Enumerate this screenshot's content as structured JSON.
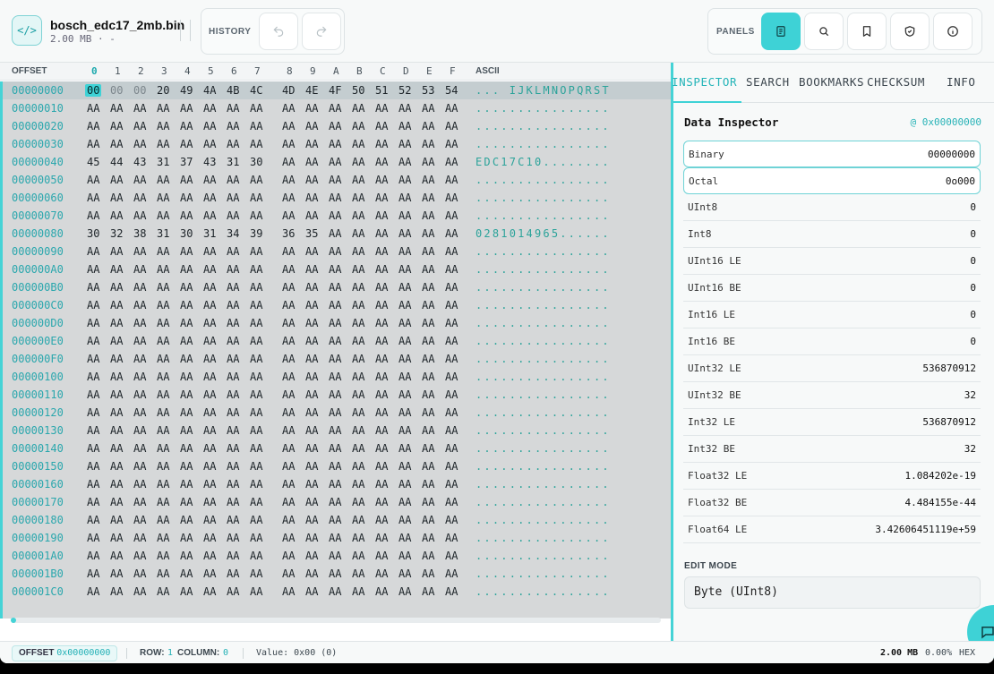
{
  "file": {
    "icon": "code-icon",
    "name": "bosch_edc17_2mb.bin",
    "meta": "2.00 MB · -"
  },
  "history": {
    "label": "HISTORY",
    "undo_icon": "undo-icon",
    "redo_icon": "redo-icon"
  },
  "panels": {
    "label": "PANELS",
    "buttons": [
      "document-icon",
      "search-icon",
      "bookmark-icon",
      "shield-check-icon",
      "info-icon"
    ]
  },
  "hex": {
    "offset_label": "OFFSET",
    "ascii_label": "ASCII",
    "columns": [
      "0",
      "1",
      "2",
      "3",
      "4",
      "5",
      "6",
      "7",
      "8",
      "9",
      "A",
      "B",
      "C",
      "D",
      "E",
      "F"
    ],
    "rows": [
      {
        "offset": "00000000",
        "bytes": [
          "00",
          "00",
          "00",
          "20",
          "49",
          "4A",
          "4B",
          "4C",
          "4D",
          "4E",
          "4F",
          "50",
          "51",
          "52",
          "53",
          "54"
        ],
        "ascii": "... IJKLMNOPQRST"
      },
      {
        "offset": "00000010",
        "bytes": [
          "AA",
          "AA",
          "AA",
          "AA",
          "AA",
          "AA",
          "AA",
          "AA",
          "AA",
          "AA",
          "AA",
          "AA",
          "AA",
          "AA",
          "AA",
          "AA"
        ],
        "ascii": "................"
      },
      {
        "offset": "00000020",
        "bytes": [
          "AA",
          "AA",
          "AA",
          "AA",
          "AA",
          "AA",
          "AA",
          "AA",
          "AA",
          "AA",
          "AA",
          "AA",
          "AA",
          "AA",
          "AA",
          "AA"
        ],
        "ascii": "................"
      },
      {
        "offset": "00000030",
        "bytes": [
          "AA",
          "AA",
          "AA",
          "AA",
          "AA",
          "AA",
          "AA",
          "AA",
          "AA",
          "AA",
          "AA",
          "AA",
          "AA",
          "AA",
          "AA",
          "AA"
        ],
        "ascii": "................"
      },
      {
        "offset": "00000040",
        "bytes": [
          "45",
          "44",
          "43",
          "31",
          "37",
          "43",
          "31",
          "30",
          "AA",
          "AA",
          "AA",
          "AA",
          "AA",
          "AA",
          "AA",
          "AA"
        ],
        "ascii": "EDC17C10........"
      },
      {
        "offset": "00000050",
        "bytes": [
          "AA",
          "AA",
          "AA",
          "AA",
          "AA",
          "AA",
          "AA",
          "AA",
          "AA",
          "AA",
          "AA",
          "AA",
          "AA",
          "AA",
          "AA",
          "AA"
        ],
        "ascii": "................"
      },
      {
        "offset": "00000060",
        "bytes": [
          "AA",
          "AA",
          "AA",
          "AA",
          "AA",
          "AA",
          "AA",
          "AA",
          "AA",
          "AA",
          "AA",
          "AA",
          "AA",
          "AA",
          "AA",
          "AA"
        ],
        "ascii": "................"
      },
      {
        "offset": "00000070",
        "bytes": [
          "AA",
          "AA",
          "AA",
          "AA",
          "AA",
          "AA",
          "AA",
          "AA",
          "AA",
          "AA",
          "AA",
          "AA",
          "AA",
          "AA",
          "AA",
          "AA"
        ],
        "ascii": "................"
      },
      {
        "offset": "00000080",
        "bytes": [
          "30",
          "32",
          "38",
          "31",
          "30",
          "31",
          "34",
          "39",
          "36",
          "35",
          "AA",
          "AA",
          "AA",
          "AA",
          "AA",
          "AA"
        ],
        "ascii": "0281014965......"
      },
      {
        "offset": "00000090",
        "bytes": [
          "AA",
          "AA",
          "AA",
          "AA",
          "AA",
          "AA",
          "AA",
          "AA",
          "AA",
          "AA",
          "AA",
          "AA",
          "AA",
          "AA",
          "AA",
          "AA"
        ],
        "ascii": "................"
      },
      {
        "offset": "000000A0",
        "bytes": [
          "AA",
          "AA",
          "AA",
          "AA",
          "AA",
          "AA",
          "AA",
          "AA",
          "AA",
          "AA",
          "AA",
          "AA",
          "AA",
          "AA",
          "AA",
          "AA"
        ],
        "ascii": "................"
      },
      {
        "offset": "000000B0",
        "bytes": [
          "AA",
          "AA",
          "AA",
          "AA",
          "AA",
          "AA",
          "AA",
          "AA",
          "AA",
          "AA",
          "AA",
          "AA",
          "AA",
          "AA",
          "AA",
          "AA"
        ],
        "ascii": "................"
      },
      {
        "offset": "000000C0",
        "bytes": [
          "AA",
          "AA",
          "AA",
          "AA",
          "AA",
          "AA",
          "AA",
          "AA",
          "AA",
          "AA",
          "AA",
          "AA",
          "AA",
          "AA",
          "AA",
          "AA"
        ],
        "ascii": "................"
      },
      {
        "offset": "000000D0",
        "bytes": [
          "AA",
          "AA",
          "AA",
          "AA",
          "AA",
          "AA",
          "AA",
          "AA",
          "AA",
          "AA",
          "AA",
          "AA",
          "AA",
          "AA",
          "AA",
          "AA"
        ],
        "ascii": "................"
      },
      {
        "offset": "000000E0",
        "bytes": [
          "AA",
          "AA",
          "AA",
          "AA",
          "AA",
          "AA",
          "AA",
          "AA",
          "AA",
          "AA",
          "AA",
          "AA",
          "AA",
          "AA",
          "AA",
          "AA"
        ],
        "ascii": "................"
      },
      {
        "offset": "000000F0",
        "bytes": [
          "AA",
          "AA",
          "AA",
          "AA",
          "AA",
          "AA",
          "AA",
          "AA",
          "AA",
          "AA",
          "AA",
          "AA",
          "AA",
          "AA",
          "AA",
          "AA"
        ],
        "ascii": "................"
      },
      {
        "offset": "00000100",
        "bytes": [
          "AA",
          "AA",
          "AA",
          "AA",
          "AA",
          "AA",
          "AA",
          "AA",
          "AA",
          "AA",
          "AA",
          "AA",
          "AA",
          "AA",
          "AA",
          "AA"
        ],
        "ascii": "................"
      },
      {
        "offset": "00000110",
        "bytes": [
          "AA",
          "AA",
          "AA",
          "AA",
          "AA",
          "AA",
          "AA",
          "AA",
          "AA",
          "AA",
          "AA",
          "AA",
          "AA",
          "AA",
          "AA",
          "AA"
        ],
        "ascii": "................"
      },
      {
        "offset": "00000120",
        "bytes": [
          "AA",
          "AA",
          "AA",
          "AA",
          "AA",
          "AA",
          "AA",
          "AA",
          "AA",
          "AA",
          "AA",
          "AA",
          "AA",
          "AA",
          "AA",
          "AA"
        ],
        "ascii": "................"
      },
      {
        "offset": "00000130",
        "bytes": [
          "AA",
          "AA",
          "AA",
          "AA",
          "AA",
          "AA",
          "AA",
          "AA",
          "AA",
          "AA",
          "AA",
          "AA",
          "AA",
          "AA",
          "AA",
          "AA"
        ],
        "ascii": "................"
      },
      {
        "offset": "00000140",
        "bytes": [
          "AA",
          "AA",
          "AA",
          "AA",
          "AA",
          "AA",
          "AA",
          "AA",
          "AA",
          "AA",
          "AA",
          "AA",
          "AA",
          "AA",
          "AA",
          "AA"
        ],
        "ascii": "................"
      },
      {
        "offset": "00000150",
        "bytes": [
          "AA",
          "AA",
          "AA",
          "AA",
          "AA",
          "AA",
          "AA",
          "AA",
          "AA",
          "AA",
          "AA",
          "AA",
          "AA",
          "AA",
          "AA",
          "AA"
        ],
        "ascii": "................"
      },
      {
        "offset": "00000160",
        "bytes": [
          "AA",
          "AA",
          "AA",
          "AA",
          "AA",
          "AA",
          "AA",
          "AA",
          "AA",
          "AA",
          "AA",
          "AA",
          "AA",
          "AA",
          "AA",
          "AA"
        ],
        "ascii": "................"
      },
      {
        "offset": "00000170",
        "bytes": [
          "AA",
          "AA",
          "AA",
          "AA",
          "AA",
          "AA",
          "AA",
          "AA",
          "AA",
          "AA",
          "AA",
          "AA",
          "AA",
          "AA",
          "AA",
          "AA"
        ],
        "ascii": "................"
      },
      {
        "offset": "00000180",
        "bytes": [
          "AA",
          "AA",
          "AA",
          "AA",
          "AA",
          "AA",
          "AA",
          "AA",
          "AA",
          "AA",
          "AA",
          "AA",
          "AA",
          "AA",
          "AA",
          "AA"
        ],
        "ascii": "................"
      },
      {
        "offset": "00000190",
        "bytes": [
          "AA",
          "AA",
          "AA",
          "AA",
          "AA",
          "AA",
          "AA",
          "AA",
          "AA",
          "AA",
          "AA",
          "AA",
          "AA",
          "AA",
          "AA",
          "AA"
        ],
        "ascii": "................"
      },
      {
        "offset": "000001A0",
        "bytes": [
          "AA",
          "AA",
          "AA",
          "AA",
          "AA",
          "AA",
          "AA",
          "AA",
          "AA",
          "AA",
          "AA",
          "AA",
          "AA",
          "AA",
          "AA",
          "AA"
        ],
        "ascii": "................"
      },
      {
        "offset": "000001B0",
        "bytes": [
          "AA",
          "AA",
          "AA",
          "AA",
          "AA",
          "AA",
          "AA",
          "AA",
          "AA",
          "AA",
          "AA",
          "AA",
          "AA",
          "AA",
          "AA",
          "AA"
        ],
        "ascii": "................"
      },
      {
        "offset": "000001C0",
        "bytes": [
          "AA",
          "AA",
          "AA",
          "AA",
          "AA",
          "AA",
          "AA",
          "AA",
          "AA",
          "AA",
          "AA",
          "AA",
          "AA",
          "AA",
          "AA",
          "AA"
        ],
        "ascii": "................"
      }
    ]
  },
  "tabs": [
    "INSPECTOR",
    "SEARCH",
    "BOOKMARKS",
    "CHECKSUM",
    "INFO"
  ],
  "inspector": {
    "title": "Data Inspector",
    "address": "@ 0x00000000",
    "fields": [
      {
        "label": "Binary",
        "value": "00000000"
      },
      {
        "label": "Octal",
        "value": "0o000"
      },
      {
        "label": "UInt8",
        "value": "0"
      },
      {
        "label": "Int8",
        "value": "0"
      },
      {
        "label": "UInt16 LE",
        "value": "0"
      },
      {
        "label": "UInt16 BE",
        "value": "0"
      },
      {
        "label": "Int16 LE",
        "value": "0"
      },
      {
        "label": "Int16 BE",
        "value": "0"
      },
      {
        "label": "UInt32 LE",
        "value": "536870912"
      },
      {
        "label": "UInt32 BE",
        "value": "32"
      },
      {
        "label": "Int32 LE",
        "value": "536870912"
      },
      {
        "label": "Int32 BE",
        "value": "32"
      },
      {
        "label": "Float32 LE",
        "value": "1.084202e-19"
      },
      {
        "label": "Float32 BE",
        "value": "4.484155e-44"
      },
      {
        "label": "Float64 LE",
        "value": "3.42606451119e+59"
      }
    ],
    "edit_mode_label": "EDIT MODE",
    "edit_mode_value": "Byte (UInt8)"
  },
  "footer": {
    "offset_label": "OFFSET",
    "offset_value": "0x00000000",
    "row_label": "ROW:",
    "row_value": "1",
    "column_label": "COLUMN:",
    "column_value": "0",
    "value_text": "Value: 0x00 (0)",
    "size": "2.00 MB",
    "percent": "0.00%",
    "mode": "HEX"
  },
  "colors": {
    "accent": "#3ed2d6",
    "offset_text": "#2aa7ad",
    "ascii_text": "#2ba39a"
  }
}
